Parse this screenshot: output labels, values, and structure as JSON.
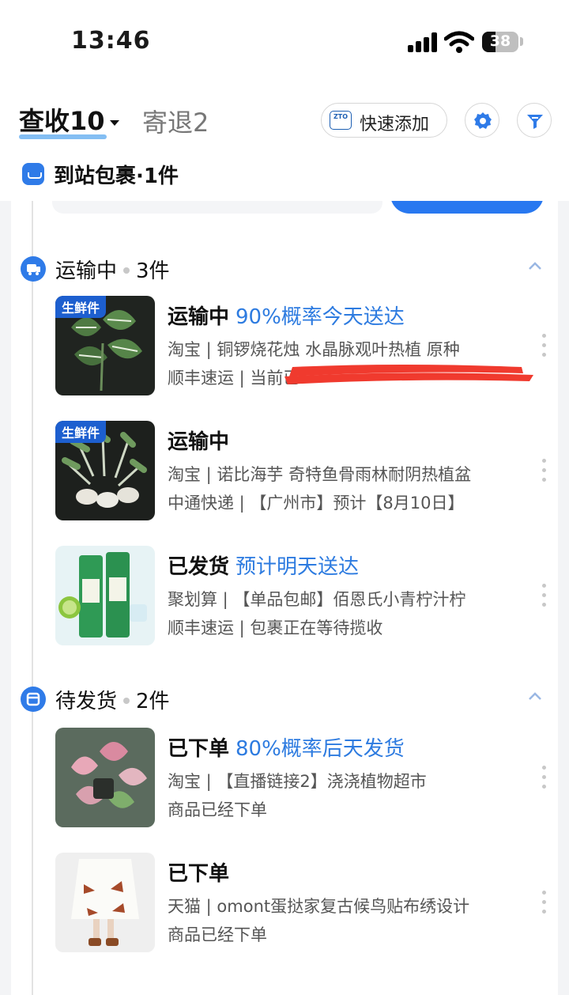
{
  "status_bar": {
    "time": "13:46",
    "battery": "38"
  },
  "header": {
    "tab_active": "查收10",
    "tab_inactive": "寄退2",
    "quick_add_label": "快速添加",
    "zto_logo_text": "ZTO"
  },
  "arrived": {
    "label": "到站包裹·1件"
  },
  "sections": [
    {
      "title": "运输中",
      "count": "3件",
      "items": [
        {
          "tag": "生鲜件",
          "status": "运输中",
          "hint": "90%概率今天送达",
          "line1": "淘宝 | 铜锣烧花烛 水晶脉观叶热植 原种",
          "line2": "顺丰速运 | 当前已"
        },
        {
          "tag": "生鲜件",
          "status": "运输中",
          "hint": "",
          "line1": "淘宝 | 诺比海芋 奇特鱼骨雨林耐阴热植盆",
          "line2": "中通快递 | 【广州市】预计【8月10日】"
        },
        {
          "tag": "",
          "status": "已发货",
          "hint": "预计明天送达",
          "line1": "聚划算 | 【单品包邮】佰恩氏小青柠汁柠",
          "line2": "顺丰速运 | 包裹正在等待揽收"
        }
      ]
    },
    {
      "title": "待发货",
      "count": "2件",
      "items": [
        {
          "tag": "",
          "status": "已下单",
          "hint": "80%概率后天发货",
          "line1": "淘宝 | 【直播链接2】浇浇植物超市",
          "line2": "商品已经下单"
        },
        {
          "tag": "",
          "status": "已下单",
          "hint": "",
          "line1": "天猫 | omont蛋挞家复古候鸟贴布绣设计",
          "line2": "商品已经下单"
        }
      ]
    }
  ],
  "colors": {
    "accent": "#2d7be0",
    "brand_blue": "#2f7be8",
    "redaction": "#f03a2e"
  }
}
